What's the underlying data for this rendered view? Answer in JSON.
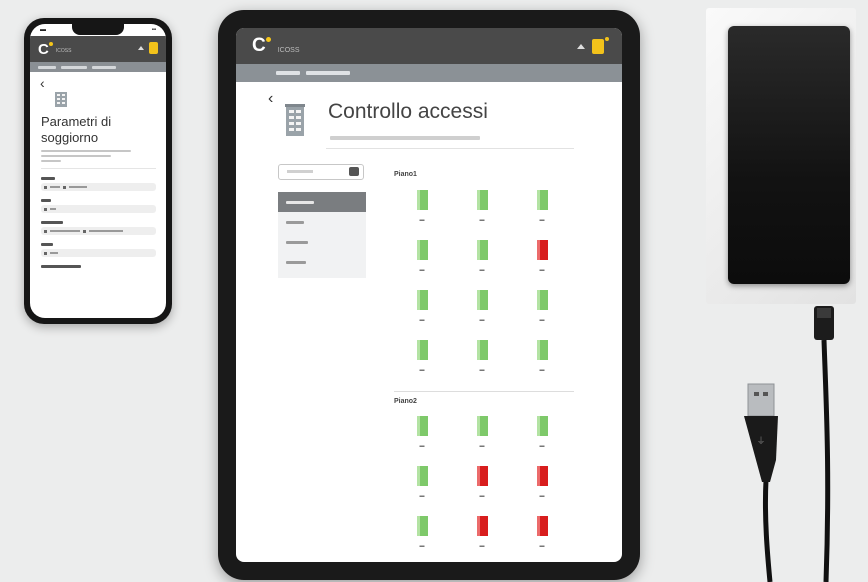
{
  "phone": {
    "app_name": "ICOSS",
    "breadcrumb": [
      "",
      "",
      ""
    ],
    "title": "Parametri di soggiorno",
    "fields": [
      {
        "label_w": 14,
        "values": [
          10,
          18
        ]
      },
      {
        "label_w": 10,
        "values": [
          6
        ]
      },
      {
        "label_w": 22,
        "values": [
          30,
          34
        ]
      },
      {
        "label_w": 12,
        "values": [
          8
        ]
      },
      {
        "label_w": 40,
        "values": []
      }
    ]
  },
  "tablet": {
    "app_name": "ICOSS",
    "page_title": "Controllo accessi",
    "section_1": "Piano1",
    "section_2": "Piano2",
    "menu": [
      "",
      "",
      "",
      ""
    ],
    "rooms_floor1": [
      {
        "status": "green"
      },
      {
        "status": "green"
      },
      {
        "status": "green"
      },
      {
        "status": "green"
      },
      {
        "status": "green"
      },
      {
        "status": "red"
      },
      {
        "status": "green"
      },
      {
        "status": "green"
      },
      {
        "status": "green"
      },
      {
        "status": "green"
      },
      {
        "status": "green"
      },
      {
        "status": "green"
      }
    ],
    "rooms_floor2": [
      {
        "status": "green"
      },
      {
        "status": "green"
      },
      {
        "status": "green"
      },
      {
        "status": "green"
      },
      {
        "status": "red"
      },
      {
        "status": "red"
      },
      {
        "status": "green"
      },
      {
        "status": "red"
      },
      {
        "status": "red"
      },
      {
        "status": "green"
      },
      {
        "status": "green"
      },
      {
        "status": "green"
      }
    ]
  },
  "colors": {
    "header": "#4a4a4a",
    "breadcrumb": "#8b9196",
    "accent_key": "#f2c21b",
    "door_open": "#7ec96a",
    "door_alarm": "#d81d1d"
  }
}
